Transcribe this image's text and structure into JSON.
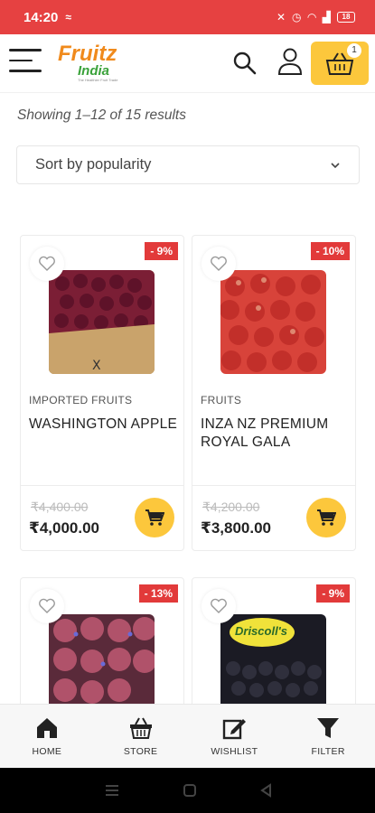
{
  "status_bar": {
    "time": "14:20",
    "battery": "18"
  },
  "header": {
    "logo": {
      "line1": "Fruitz",
      "line2": "India",
      "tagline": "The Healthier Fruit Trade"
    },
    "cart_count": "1"
  },
  "listing": {
    "result_text": "Showing 1–12 of 15 results",
    "sort_value": "Sort by popularity"
  },
  "products": [
    {
      "discount": "- 9%",
      "category": "IMPORTED FRUITS",
      "name": "WASHINGTON APPLE",
      "old_price": "₹4,400.00",
      "price": "₹4,000.00",
      "image": "red-apples-box"
    },
    {
      "discount": "- 10%",
      "category": "FRUITS",
      "name": "INZA NZ PREMIUM ROYAL GALA",
      "old_price": "₹4,200.00",
      "price": "₹3,800.00",
      "image": "gala-apples-box"
    },
    {
      "discount": "- 13%",
      "category": "",
      "name": "",
      "old_price": "",
      "price": "",
      "image": "plums-tray"
    },
    {
      "discount": "- 9%",
      "category": "",
      "name": "",
      "old_price": "",
      "price": "",
      "image": "blackberries-pack",
      "brand_text": "Driscoll's"
    }
  ],
  "bottom_nav": {
    "items": [
      {
        "label": "HOME",
        "icon": "home-icon"
      },
      {
        "label": "STORE",
        "icon": "basket-icon"
      },
      {
        "label": "WISHLIST",
        "icon": "edit-icon"
      },
      {
        "label": "FILTER",
        "icon": "filter-icon"
      }
    ]
  },
  "colors": {
    "brand_red": "#e64141",
    "accent_yellow": "#fcc73c",
    "discount_red": "#e23a3a"
  }
}
